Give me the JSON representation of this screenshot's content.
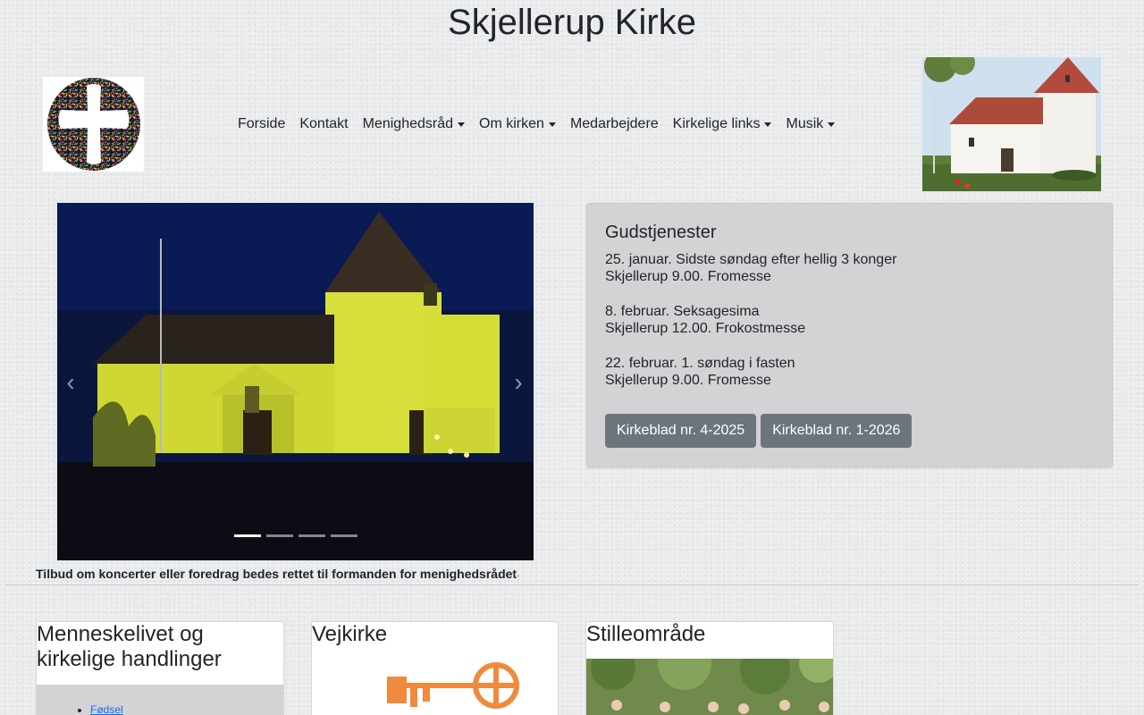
{
  "site": {
    "title": "Skjellerup Kirke"
  },
  "nav": {
    "items": [
      {
        "label": "Forside",
        "dropdown": false
      },
      {
        "label": "Kontakt",
        "dropdown": false
      },
      {
        "label": "Menighedsråd",
        "dropdown": true
      },
      {
        "label": "Om kirken",
        "dropdown": true
      },
      {
        "label": "Medarbejdere",
        "dropdown": false
      },
      {
        "label": "Kirkelige links",
        "dropdown": true
      },
      {
        "label": "Musik",
        "dropdown": true
      }
    ]
  },
  "carousel": {
    "prev_icon": "chevron-left-icon",
    "next_icon": "chevron-right-icon",
    "indicator_count": 4,
    "active_index": 0
  },
  "services": {
    "heading": "Gudstjenester",
    "entries": [
      {
        "line1": "25. januar. Sidste søndag efter hellig 3 konger",
        "line2": "Skjellerup 9.00. Fromesse"
      },
      {
        "line1": "8. februar. Seksagesima",
        "line2": "Skjellerup 12.00. Frokostmesse"
      },
      {
        "line1": "22. februar. 1. søndag i fasten",
        "line2": "Skjellerup 9.00. Fromesse"
      }
    ],
    "buttons": [
      "Kirkeblad nr. 4-2025",
      "Kirkeblad nr. 1-2026"
    ]
  },
  "notice": "Tilbud om koncerter eller foredrag bedes rettet til formanden for menighedsrådet",
  "cards": {
    "menneskelivet": {
      "title": "Menneskelivet og kirkelige handlinger",
      "links": [
        "Fødsel"
      ]
    },
    "vejkirke": {
      "title": "Vejkirke"
    },
    "stilleomraade": {
      "title": "Stilleområde"
    }
  },
  "colors": {
    "panel": "#d3d2d4",
    "button": "#6c757d",
    "vejkirke_key": "#f08a3c",
    "link": "#0d6efd"
  }
}
